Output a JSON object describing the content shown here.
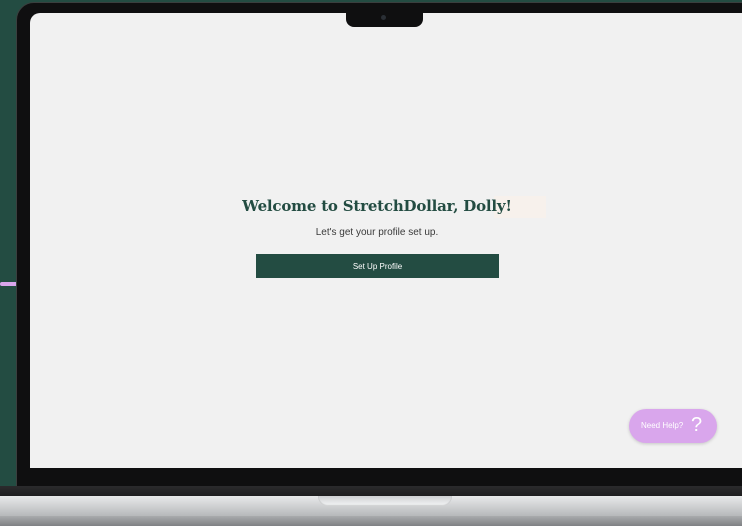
{
  "welcome": {
    "title": "Welcome to StretchDollar, Dolly!",
    "subtitle": "Let's get your profile set up.",
    "setup_button_label": "Set Up Profile"
  },
  "help": {
    "label": "Need Help?",
    "icon": "question-mark-icon",
    "icon_glyph": "?"
  },
  "colors": {
    "brand_green": "#234c42",
    "accent_lilac": "#d9a6ec",
    "screen_bg": "#f1f1f1"
  }
}
